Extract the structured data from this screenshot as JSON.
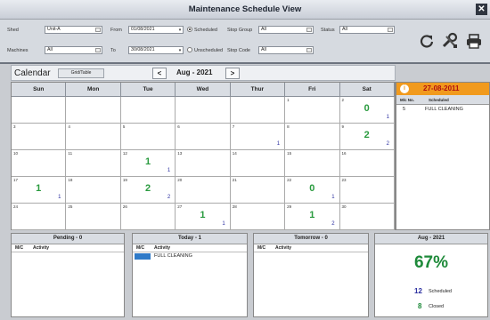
{
  "window": {
    "title": "Maintenance Schedule View",
    "close": "✕"
  },
  "filters": {
    "shed_label": "Shed",
    "shed_value": "Unit-A",
    "machines_label": "Machines",
    "machines_value": "All",
    "from_label": "From",
    "from_value": "01/08/2021",
    "to_label": "To",
    "to_value": "30/08/2021",
    "scheduled_label": "Scheduled",
    "unscheduled_label": "Unscheduled",
    "stop_group_label": "Stop Group",
    "stop_group_value": "All",
    "stop_code_label": "Stop Code",
    "stop_code_value": "All",
    "status_label": "Status",
    "status_value": "All"
  },
  "calendar": {
    "title": "Calendar",
    "grid_button": "Grid/Table",
    "prev": "<",
    "next": ">",
    "month": "Aug - 2021",
    "days": [
      "Sun",
      "Mon",
      "Tue",
      "Wed",
      "Thur",
      "Fri",
      "Sat"
    ],
    "weeks": [
      [
        {
          "d": ""
        },
        {
          "d": ""
        },
        {
          "d": ""
        },
        {
          "d": ""
        },
        {
          "d": ""
        },
        {
          "d": "1"
        },
        {
          "d": "2",
          "b": "0",
          "s": "1"
        }
      ],
      [
        {
          "d": "3"
        },
        {
          "d": "4"
        },
        {
          "d": "5"
        },
        {
          "d": "6"
        },
        {
          "d": "7",
          "s": "1"
        },
        {
          "d": "8"
        },
        {
          "d": "9",
          "b": "2",
          "s": "2"
        }
      ],
      [
        {
          "d": "10"
        },
        {
          "d": "11"
        },
        {
          "d": "12",
          "b": "1",
          "s": "1"
        },
        {
          "d": "13"
        },
        {
          "d": "14"
        },
        {
          "d": "15"
        },
        {
          "d": "16"
        }
      ],
      [
        {
          "d": "17",
          "b": "1",
          "s": "1"
        },
        {
          "d": "18"
        },
        {
          "d": "19",
          "b": "2",
          "s": "2"
        },
        {
          "d": "20"
        },
        {
          "d": "21"
        },
        {
          "d": "22",
          "b": "0",
          "s": "1"
        },
        {
          "d": "23"
        }
      ],
      [
        {
          "d": "24"
        },
        {
          "d": "25"
        },
        {
          "d": "26"
        },
        {
          "d": "27",
          "b": "1",
          "s": "1"
        },
        {
          "d": "28"
        },
        {
          "d": "29",
          "b": "1",
          "s": "2"
        },
        {
          "d": "30"
        }
      ]
    ]
  },
  "selected_day": {
    "date": "27-08-2011",
    "col_mc": "M/c No.",
    "col_scheduled": "Scheduled",
    "rows": [
      {
        "mc": "5",
        "activity": "FULL CLEANING"
      }
    ]
  },
  "pending": {
    "title": "Pending - 0",
    "col_mc": "M/C",
    "col_activity": "Activity"
  },
  "today": {
    "title": "Today - 1",
    "col_mc": "M/C",
    "col_activity": "Activity",
    "rows": [
      {
        "mc": "",
        "activity": "FULL CLEANING"
      }
    ]
  },
  "tomorrow": {
    "title": "Tomorrow - 0",
    "col_mc": "M/C",
    "col_activity": "Activity"
  },
  "summary": {
    "title": "Aug - 2021",
    "percent": "67%",
    "scheduled_count": "12",
    "scheduled_label": "Scheduled",
    "closed_count": "8",
    "closed_label": "Closed"
  },
  "colors": {
    "accent": "#f19a1d",
    "green": "#2a9b3f",
    "blue": "#2b2fa0"
  }
}
